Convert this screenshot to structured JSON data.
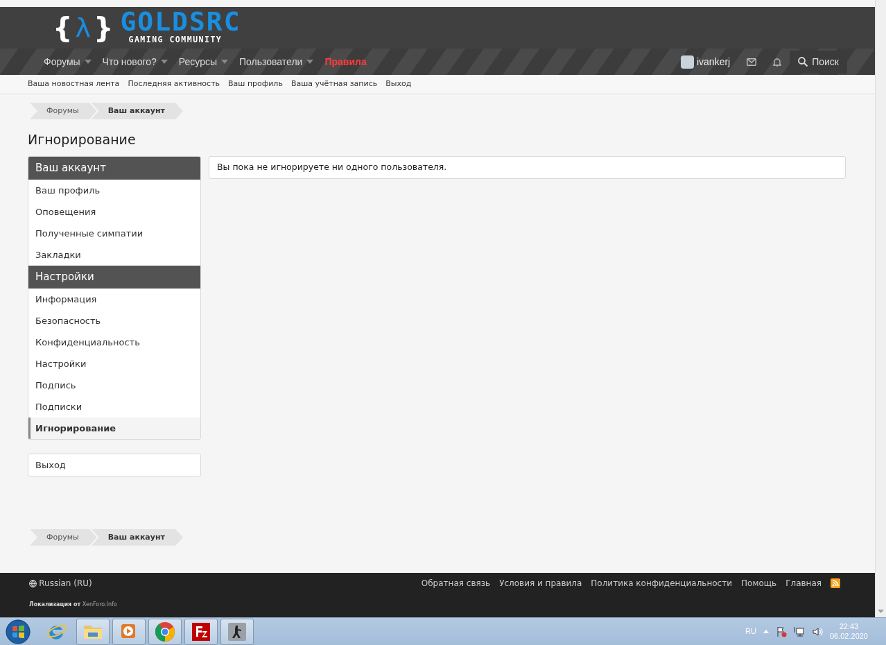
{
  "logo": {
    "symbol_left": "{",
    "symbol_mid": "λ",
    "symbol_right": "}",
    "title": "GOLDSRC",
    "subtitle": "GAMING COMMUNITY"
  },
  "nav": [
    {
      "label": "Форумы",
      "dropdown": true,
      "highlight": false
    },
    {
      "label": "Что нового?",
      "dropdown": true,
      "highlight": false
    },
    {
      "label": "Ресурсы",
      "dropdown": true,
      "highlight": false
    },
    {
      "label": "Пользователи",
      "dropdown": true,
      "highlight": false
    },
    {
      "label": "Правила",
      "dropdown": false,
      "highlight": true
    }
  ],
  "user": {
    "name": "ivankerj"
  },
  "search": {
    "label": "Поиск"
  },
  "subnav": [
    "Ваша новостная лента",
    "Последняя активность",
    "Ваш профиль",
    "Ваша учётная запись",
    "Выход"
  ],
  "breadcrumbs": [
    {
      "label": "Форумы",
      "current": false
    },
    {
      "label": "Ваш аккаунт",
      "current": true
    }
  ],
  "page_title": "Игнорирование",
  "sidebar": {
    "sections": [
      {
        "title": "Ваш аккаунт",
        "items": [
          {
            "label": "Ваш профиль",
            "selected": false
          },
          {
            "label": "Оповещения",
            "selected": false
          },
          {
            "label": "Полученные симпатии",
            "selected": false
          },
          {
            "label": "Закладки",
            "selected": false
          }
        ]
      },
      {
        "title": "Настройки",
        "items": [
          {
            "label": "Информация",
            "selected": false
          },
          {
            "label": "Безопасность",
            "selected": false
          },
          {
            "label": "Конфиденциальность",
            "selected": false
          },
          {
            "label": "Настройки",
            "selected": false
          },
          {
            "label": "Подпись",
            "selected": false
          },
          {
            "label": "Подписки",
            "selected": false
          },
          {
            "label": "Игнорирование",
            "selected": true
          }
        ]
      }
    ],
    "logout": "Выход"
  },
  "message": "Вы пока не игнорируете ни одного пользователя.",
  "bottom_breadcrumbs": [
    {
      "label": "Форумы",
      "current": false
    },
    {
      "label": "Ваш аккаунт",
      "current": true
    }
  ],
  "footer": {
    "language": "Russian (RU)",
    "links": [
      "Обратная связь",
      "Условия и правила",
      "Политика конфиденциальности",
      "Помощь",
      "Главная"
    ],
    "credit_prefix": "Локализация от",
    "credit_link": "XenForo.Info"
  },
  "taskbar": {
    "apps": [
      {
        "kind": "ie",
        "running": false
      },
      {
        "kind": "explorer",
        "running": true
      },
      {
        "kind": "media",
        "running": true
      },
      {
        "kind": "chrome",
        "running": true
      },
      {
        "kind": "filezilla",
        "running": true
      },
      {
        "kind": "game",
        "running": true
      }
    ],
    "language": "RU",
    "time": "22:43",
    "date": "06.02.2020"
  }
}
